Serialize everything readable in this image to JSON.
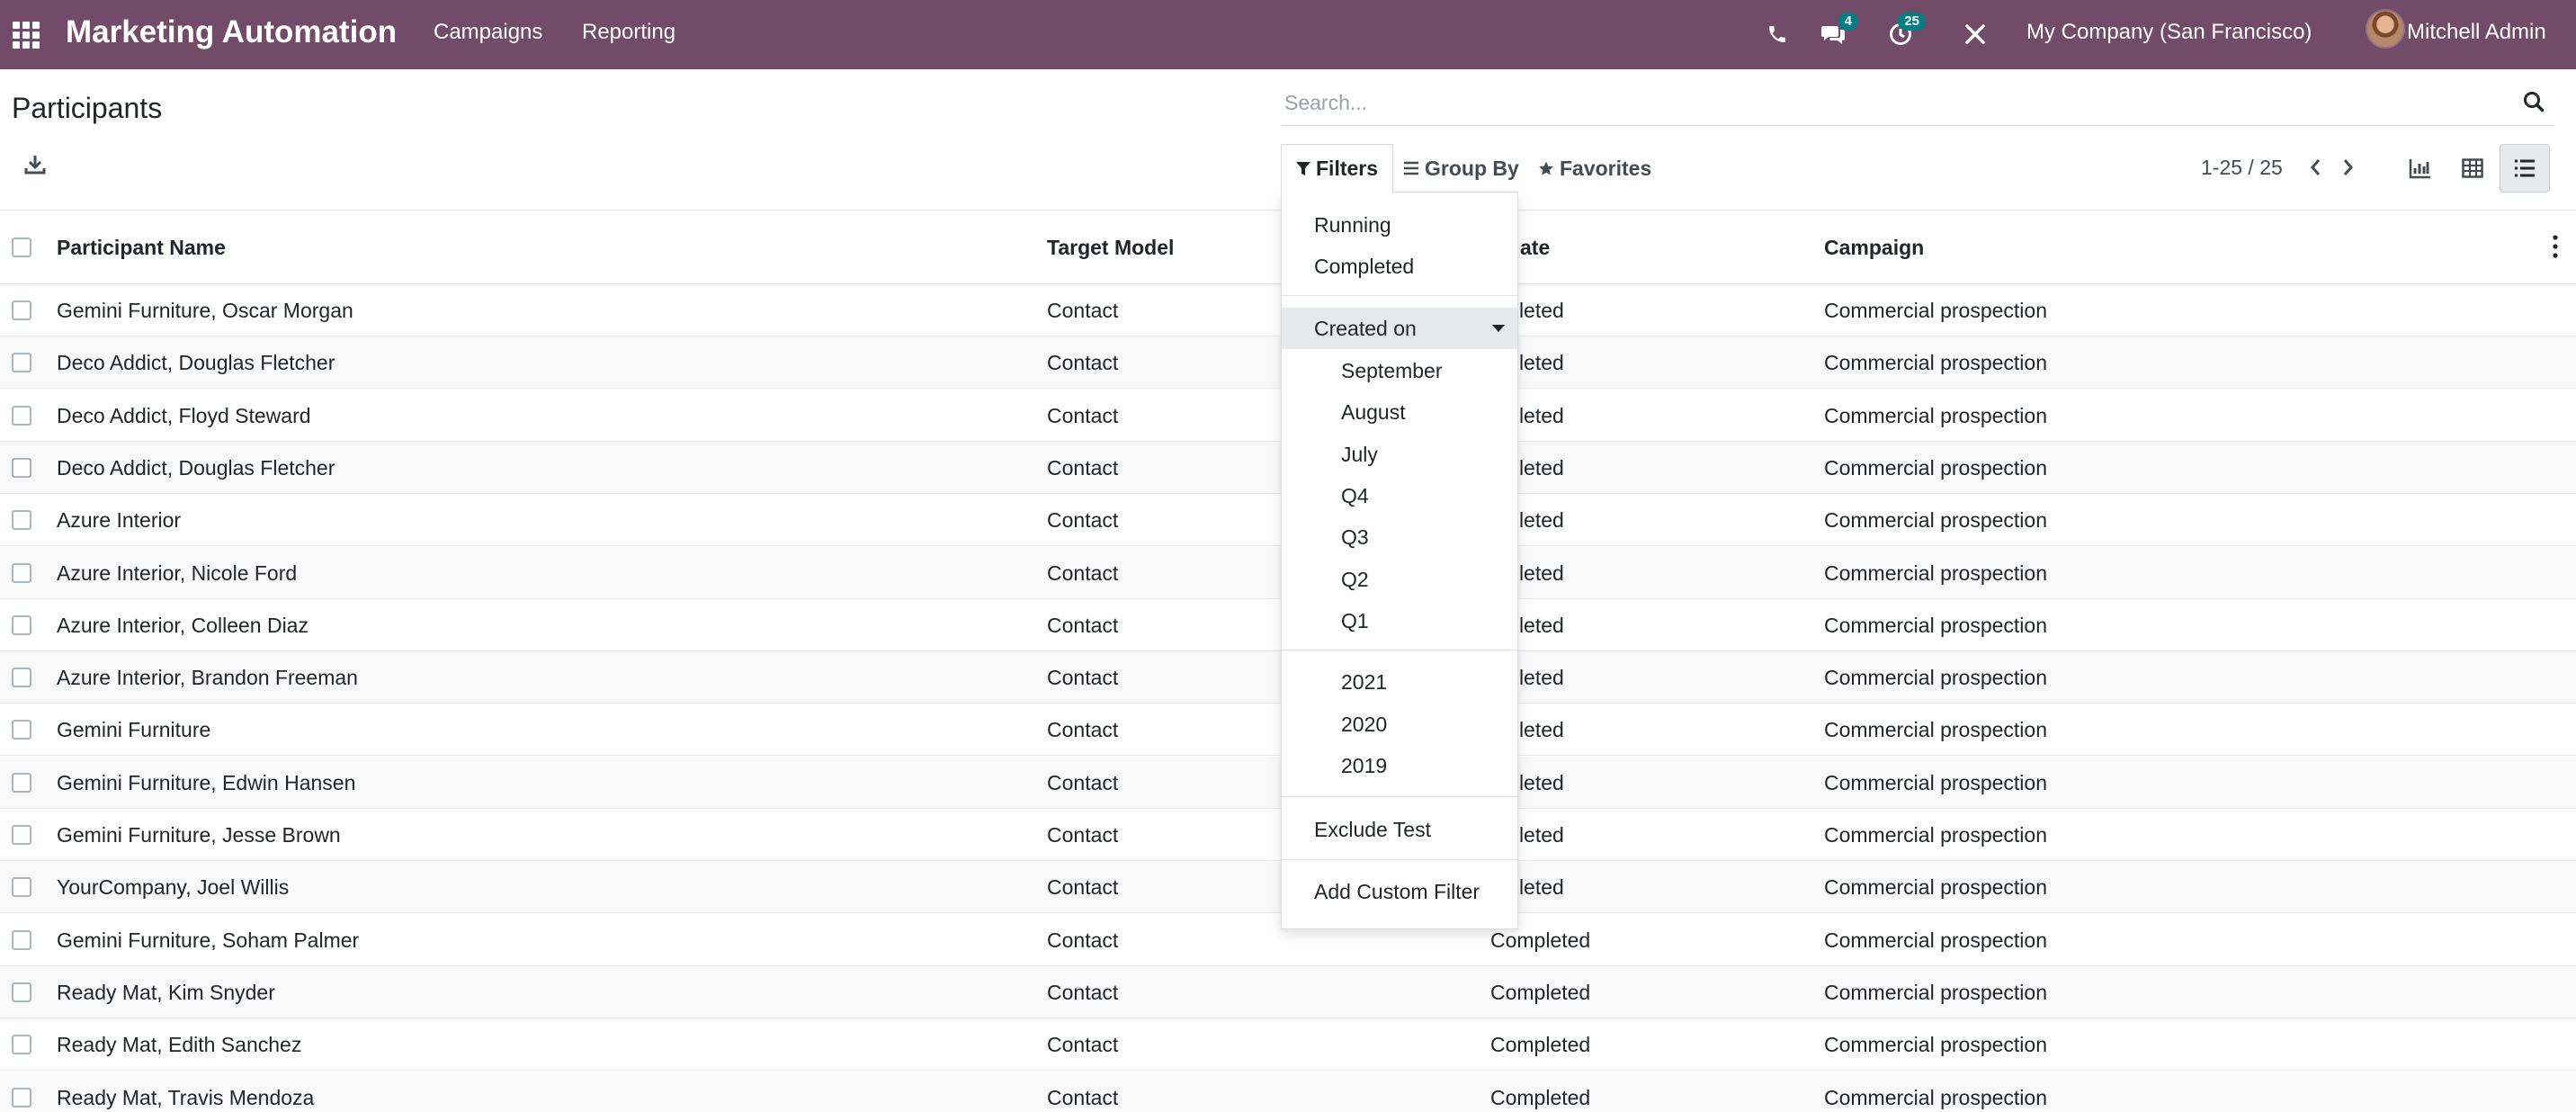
{
  "navbar": {
    "app_title": "Marketing Automation",
    "menu": [
      "Campaigns",
      "Reporting"
    ],
    "messages_badge": "4",
    "activities_badge": "25",
    "company": "My Company (San Francisco)",
    "user": "Mitchell Admin",
    "colors": {
      "navbar_bg": "#714B67",
      "badge_bg": "#017e84"
    }
  },
  "control_panel": {
    "title": "Participants",
    "search_placeholder": "Search...",
    "filters_label": "Filters",
    "group_by_label": "Group By",
    "favorites_label": "Favorites",
    "pager": "1-25 / 25",
    "views": [
      "graph-view",
      "pivot-view",
      "list-view"
    ],
    "active_view": "list-view"
  },
  "filters_menu": {
    "running": "Running",
    "completed": "Completed",
    "created_on": "Created on",
    "months": [
      "September",
      "August",
      "July"
    ],
    "quarters": [
      "Q4",
      "Q3",
      "Q2",
      "Q1"
    ],
    "years": [
      "2021",
      "2020",
      "2019"
    ],
    "exclude_test": "Exclude Test",
    "add_custom": "Add Custom Filter"
  },
  "table": {
    "headers": [
      "Participant Name",
      "Target Model",
      "ate",
      "Campaign"
    ],
    "rows": [
      [
        "Gemini Furniture, Oscar Morgan",
        "Contact",
        "mpleted",
        "Commercial prospection"
      ],
      [
        "Deco Addict, Douglas Fletcher",
        "Contact",
        "mpleted",
        "Commercial prospection"
      ],
      [
        "Deco Addict, Floyd Steward",
        "Contact",
        "mpleted",
        "Commercial prospection"
      ],
      [
        "Deco Addict, Douglas Fletcher",
        "Contact",
        "mpleted",
        "Commercial prospection"
      ],
      [
        "Azure Interior",
        "Contact",
        "mpleted",
        "Commercial prospection"
      ],
      [
        "Azure Interior, Nicole Ford",
        "Contact",
        "mpleted",
        "Commercial prospection"
      ],
      [
        "Azure Interior, Colleen Diaz",
        "Contact",
        "mpleted",
        "Commercial prospection"
      ],
      [
        "Azure Interior, Brandon Freeman",
        "Contact",
        "mpleted",
        "Commercial prospection"
      ],
      [
        "Gemini Furniture",
        "Contact",
        "mpleted",
        "Commercial prospection"
      ],
      [
        "Gemini Furniture, Edwin Hansen",
        "Contact",
        "mpleted",
        "Commercial prospection"
      ],
      [
        "Gemini Furniture, Jesse Brown",
        "Contact",
        "mpleted",
        "Commercial prospection"
      ],
      [
        "YourCompany, Joel Willis",
        "Contact",
        "mpleted",
        "Commercial prospection"
      ],
      [
        "Gemini Furniture, Soham Palmer",
        "Contact",
        "Completed",
        "Commercial prospection"
      ],
      [
        "Ready Mat, Kim Snyder",
        "Contact",
        "Completed",
        "Commercial prospection"
      ],
      [
        "Ready Mat, Edith Sanchez",
        "Contact",
        "Completed",
        "Commercial prospection"
      ],
      [
        "Ready Mat, Travis Mendoza",
        "Contact",
        "Completed",
        "Commercial prospection"
      ]
    ]
  }
}
